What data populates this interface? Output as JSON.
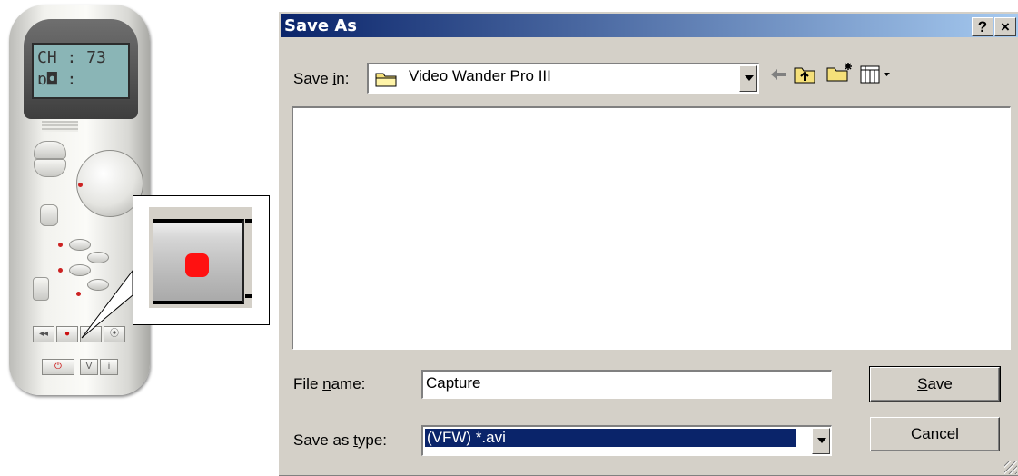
{
  "remote": {
    "lcd_line1": "CH : 73",
    "lcd_line2": "ɒ◘ :",
    "key_prev": "◂◂",
    "key_rec": "●",
    "key_power": "⏻",
    "key_v": "V",
    "key_i": "i",
    "key_mode": "⦿"
  },
  "callout": {
    "icon": "record-icon",
    "accent": "#ff1111"
  },
  "dialog": {
    "title": "Save As",
    "help_btn": "?",
    "close_btn": "×",
    "save_in_label_pre": "Save ",
    "save_in_label_key": "i",
    "save_in_label_post": "n:",
    "save_in_value": "Video Wander Pro III",
    "file_name_label_pre": "File ",
    "file_name_label_key": "n",
    "file_name_label_post": "ame:",
    "file_name_value": "Capture",
    "save_type_label_pre": "Save as ",
    "save_type_label_key": "t",
    "save_type_label_post": "ype:",
    "save_type_value": "(VFW) *.avi",
    "save_button_key": "S",
    "save_button_rest": "ave",
    "cancel_button": "Cancel",
    "colors": {
      "titlebar": "#0a246a",
      "face": "#d4d0c8",
      "selection": "#0a246a"
    }
  }
}
